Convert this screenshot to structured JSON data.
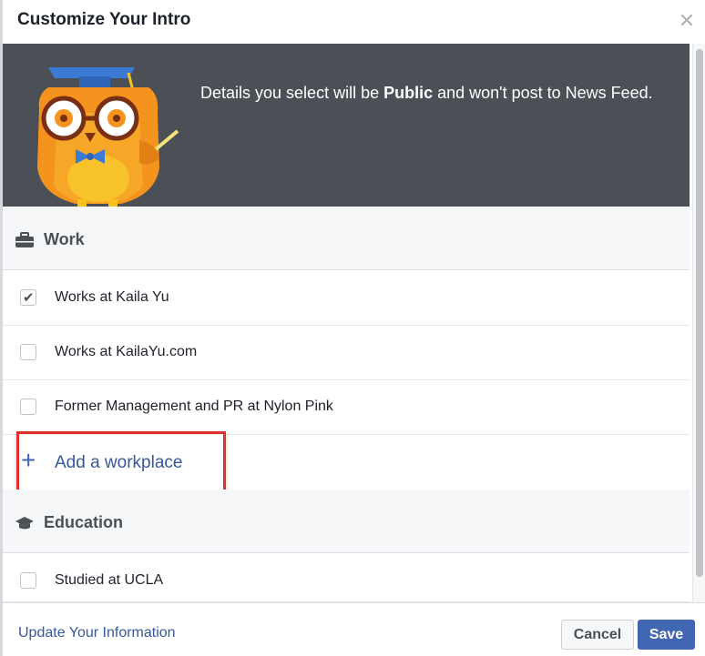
{
  "dialog": {
    "title": "Customize Your Intro",
    "close_icon": "close-icon"
  },
  "banner": {
    "text_before": "Details you select will be ",
    "text_bold": "Public",
    "text_after": " and won't post to News Feed.",
    "illustration": "owl-graduate-illustration"
  },
  "work": {
    "heading": "Work",
    "icon": "briefcase-icon",
    "items": [
      {
        "label": "Works at Kaila Yu",
        "checked": true
      },
      {
        "label": "Works at KailaYu.com",
        "checked": false
      },
      {
        "label": "Former Management and PR at Nylon Pink",
        "checked": false
      }
    ],
    "add_label": "Add a workplace",
    "add_icon": "plus-icon"
  },
  "education": {
    "heading": "Education",
    "icon": "graduation-cap-icon",
    "items": [
      {
        "label": "Studied at UCLA",
        "checked": false
      }
    ]
  },
  "footer": {
    "update_link": "Update Your Information",
    "cancel_label": "Cancel",
    "save_label": "Save"
  },
  "colors": {
    "banner_bg": "#4b4f56",
    "link_blue": "#365899",
    "save_blue": "#4267b2",
    "highlight_red": "#e02f2f"
  }
}
